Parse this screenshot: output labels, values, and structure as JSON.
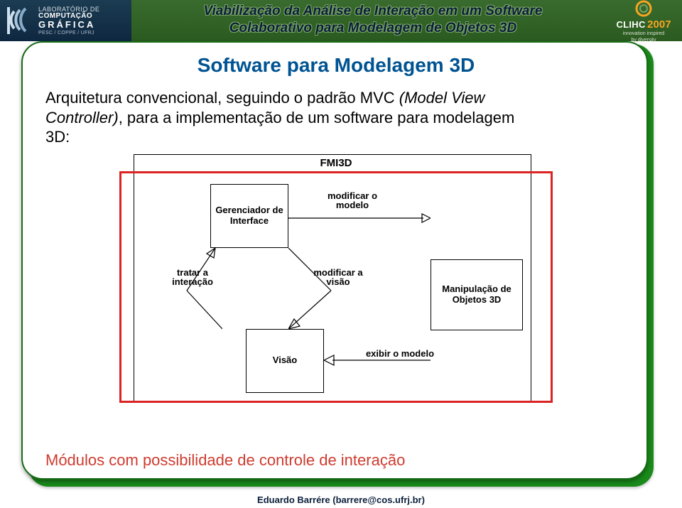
{
  "header": {
    "title_line1": "Viabilização da Análise de Interação em um Software",
    "title_line2": "Colaborativo para Modelagem de Objetos 3D",
    "logo_left": {
      "line1": "LABORATÓRIO DE",
      "line2": "COMPUTAÇÃO",
      "line3": "GRÁFICA",
      "subline": "PESC / COPPE / UFRJ"
    },
    "logo_right": {
      "title": "CLIHC",
      "year": "2007",
      "tagline1": "innovation inspired",
      "tagline2": "by diversity"
    }
  },
  "section_title": "Software para Modelagem 3D",
  "body": {
    "line1_prefix": "Arquitetura convencional, seguindo o padrão MVC ",
    "line1_italic": "(Model View",
    "line2_italic": "Controller)",
    "line2_suffix": ", para a implementação de um software para modelagem",
    "line3": "3D:"
  },
  "diagram": {
    "title": "FMI3D",
    "boxes": {
      "gerenciador": "Gerenciador de Interface",
      "manipulacao": "Manipulação de Objetos 3D",
      "visao": "Visão"
    },
    "relations": {
      "modificar_modelo": "modificar o modelo",
      "tratar_interacao": "tratar a interação",
      "modificar_visao": "modificar a visão",
      "exibir_modelo": "exibir o modelo"
    }
  },
  "bottom_note": "Módulos com possibilidade de controle de interação",
  "footer": "Eduardo Barrére (barrere@cos.ufrj.br)"
}
